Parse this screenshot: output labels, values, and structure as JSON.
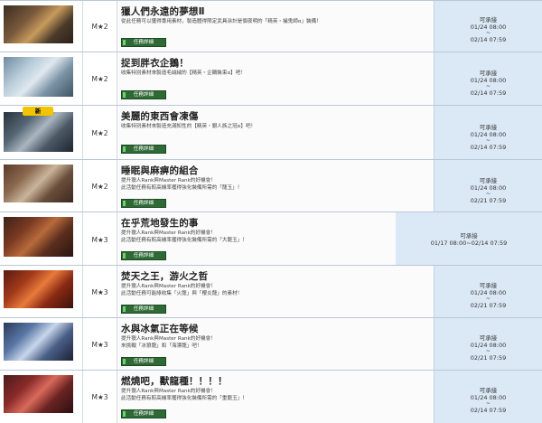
{
  "button_label": "任務詳細",
  "rows": [
    {
      "title": "獵人們永遠的夢想Ⅱ",
      "rank": "M★2",
      "desc": [
        "從此任務可以獲得專用素材，製造體得限定武具涂計是個夜明的「精英・捕鬼師α」裝備！"
      ],
      "status": "可承接",
      "start": "01/24 08:00",
      "sep": "~",
      "end": "02/14 07:59"
    },
    {
      "title": "捉到胖衣企鵝！",
      "rank": "M★2",
      "desc": [
        "收集特別素材來製造毛絨絨的【精英・企鵝裝束α】吧！"
      ],
      "status": "可承接",
      "start": "01/24 08:00",
      "sep": "~",
      "end": "02/14 07:59"
    },
    {
      "title": "美麗的東西會凍傷",
      "rank": "M★2",
      "badge": "新",
      "desc": [
        "收集特別素材來製造充滿知性的【精英・銀人族之冠α】吧！"
      ],
      "status": "可承接",
      "start": "01/24 08:00",
      "sep": "~",
      "end": "02/14 07:59"
    },
    {
      "title": "睡眠與麻痹的組合",
      "rank": "M★2",
      "desc": [
        "提升獵人Rank與Master Rank的好機會！",
        "此活動任務有較高機率獲得強化裝備所需的「龍玉」！"
      ],
      "status": "可承接",
      "start": "01/24 08:00",
      "sep": "~",
      "end": "02/21 07:59"
    },
    {
      "title": "在乎荒地發生的事",
      "rank": "M★3",
      "desc": [
        "提升獵人Rank與Master Rank的好機會！",
        "此活動任務有較高機率獲得強化裝備所需的「大龍玉」！"
      ],
      "status": "可承接",
      "range": "01/17 08:00~02/14 07:59"
    },
    {
      "title": "焚天之王，游火之哲",
      "rank": "M★3",
      "desc": [
        "提升獵人Rank與Master Rank的好機會！",
        "此活動任務可能綠收集「火龍」與「櫻炎龍」的素材！"
      ],
      "status": "可承接",
      "start": "01/24 08:00",
      "sep": "~",
      "end": "02/21 07:59"
    },
    {
      "title": "水與冰氣正在等候",
      "rank": "M★3",
      "desc": [
        "提升獵人Rank與Master Rank的好機會！",
        "來挑戰「冰狼龍」和「海漂龍」吧！"
      ],
      "status": "可承接",
      "start": "01/24 08:00",
      "sep": "~",
      "end": "02/21 07:59"
    },
    {
      "title": "燃燒吧，獸龍種！！！！",
      "rank": "M★3",
      "desc": [
        "提升獵人Rank與Master Rank的好機會！",
        "此活動任務有較高機率獲得強化裝備所需的「重龍玉」！"
      ],
      "status": "可承接",
      "start": "01/24 08:00",
      "sep": "~",
      "end": "02/14 07:59"
    }
  ]
}
